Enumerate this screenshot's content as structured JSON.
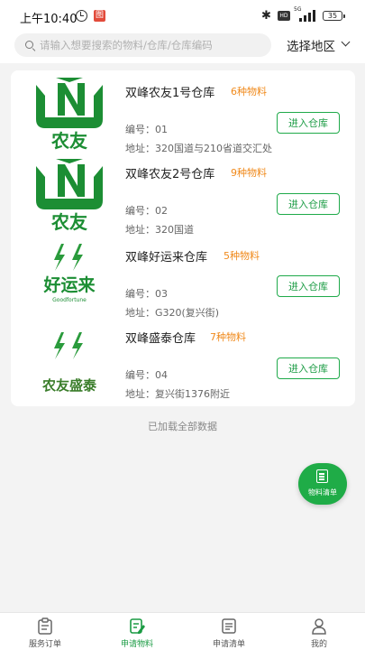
{
  "status_bar": {
    "time": "上午10:40",
    "battery": "35",
    "app_badge": "图",
    "network": "5G"
  },
  "search": {
    "placeholder": "请输入想要搜索的物料/仓库/仓库编码",
    "value": ""
  },
  "region": {
    "label": "选择地区"
  },
  "warehouses": [
    {
      "name": "双峰农友1号仓库",
      "count": "6种物料",
      "code": "编号：01",
      "address": "地址：320国道与210省道交汇处",
      "button": "进入仓库",
      "logo": "nongyou",
      "logo_text": "农友"
    },
    {
      "name": "双峰农友2号仓库",
      "count": "9种物料",
      "code": "编号：02",
      "address": "地址：320国道",
      "button": "进入仓库",
      "logo": "nongyou",
      "logo_text": "农友"
    },
    {
      "name": "双峰好运来仓库",
      "count": "5种物料",
      "code": "编号：03",
      "address": "地址：G320(复兴街)",
      "button": "进入仓库",
      "logo": "haoyunlai",
      "logo_text": "好运来",
      "logo_sub": "Goodfortune"
    },
    {
      "name": "双峰盛泰仓库",
      "count": "7种物料",
      "code": "编号：04",
      "address": "地址：复兴街1376附近",
      "button": "进入仓库",
      "logo": "nongyoushengtai",
      "logo_text": "农友盛泰"
    }
  ],
  "footer_text": "已加载全部数据",
  "fab": {
    "label": "物料清单",
    "icon": "list-icon"
  },
  "tabs": [
    {
      "label": "服务订单",
      "icon": "clipboard-icon",
      "active": false
    },
    {
      "label": "申请物料",
      "icon": "edit-document-icon",
      "active": true
    },
    {
      "label": "申请清单",
      "icon": "document-list-icon",
      "active": false
    },
    {
      "label": "我的",
      "icon": "user-icon",
      "active": false
    }
  ],
  "colors": {
    "accent": "#1FAC47",
    "count": "#F08A1C",
    "logo_green": "#1C8E34"
  }
}
